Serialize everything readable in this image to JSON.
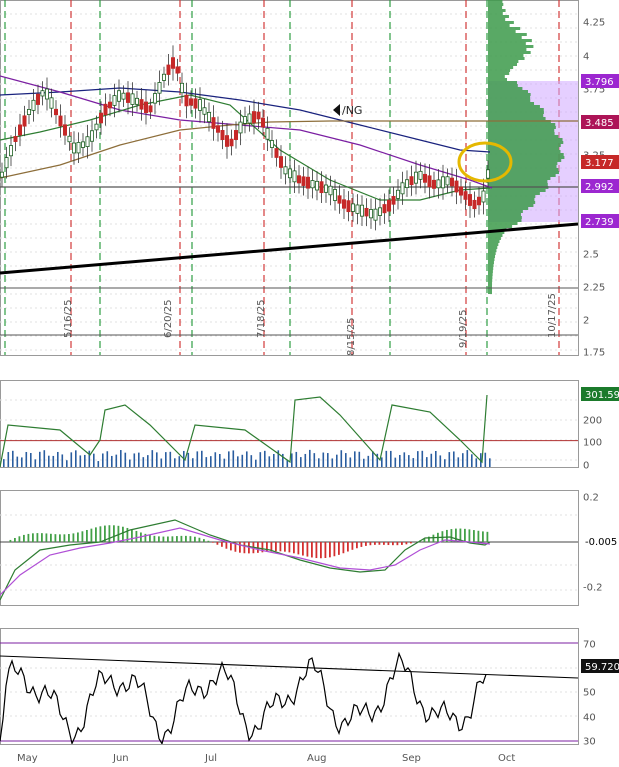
{
  "chart_data": {
    "type": "candlestick",
    "symbol_label": "/NG",
    "colors": {
      "up": "#2e7d32",
      "down": "#c62828",
      "sma_fast": "#2e7d32",
      "sma_mid": "#7b1fa2",
      "sma_slow": "#1a237e",
      "sma_long": "#8d6e3a",
      "trend": "#000000",
      "volume_profile": "#3c9a4a",
      "value_area": "#cfa8ff",
      "macd": "#2e7d32",
      "signal": "#b04fd6",
      "rsi": "#000000",
      "highlight": "#e5b800",
      "vline_green": "#2e9e44",
      "vline_red": "#d33a3a"
    },
    "x_axis": {
      "months": [
        "May",
        "Jun",
        "Jul",
        "Aug",
        "Sep",
        "Oct"
      ],
      "dates": [
        "5/16/25",
        "6/20/25",
        "7/18/25",
        "8/15/25",
        "9/19/25",
        "10/17/25"
      ]
    },
    "price_panel": {
      "ylim": [
        1.75,
        4.4
      ],
      "ticks": [
        "1.75",
        "2",
        "2.25",
        "2.5",
        "2.75",
        "3",
        "3.25",
        "3.5",
        "3.75",
        "4",
        "4.25"
      ],
      "levels": {
        "high_tag": "3.796",
        "sma_long_tag": "3.485",
        "last_tag": "3.177",
        "support_tag": "2.992",
        "low_tag": "2.739"
      },
      "horizontal_lines": [
        2.97,
        2.25,
        1.88
      ]
    },
    "volume_panel": {
      "ticks": [
        "0",
        "100",
        "200",
        "300"
      ],
      "last_tag": "301.59"
    },
    "macd_panel": {
      "ticks": [
        "0.2",
        "-0.2"
      ],
      "last_tag": "-0.005"
    },
    "rsi_panel": {
      "ticks": [
        "30",
        "40",
        "50",
        "60",
        "70"
      ],
      "last_tag": "59.720"
    }
  }
}
